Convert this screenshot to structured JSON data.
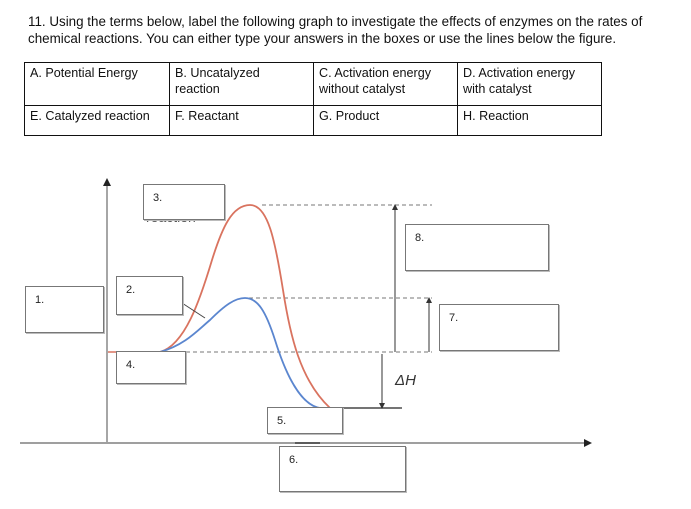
{
  "question": {
    "text": "11.  Using the terms below, label the following graph to investigate the effects of enzymes on the rates of chemical reactions. You can either type your answers in the boxes or use the lines below the figure."
  },
  "terms": [
    [
      "A. Potential Energy",
      "B. Uncatalyzed reaction",
      "C. Activation energy without catalyst",
      "D. Activation energy with catalyst"
    ],
    [
      "E. Catalyzed reaction",
      "F. Reactant",
      "G. Product",
      "H. Reaction"
    ]
  ],
  "diagram": {
    "delta_h_label": "ΔH",
    "stray_text": "reaction",
    "curves": {
      "uncatalyzed_color": "#d9735f",
      "catalyzed_color": "#5b86cf"
    },
    "answer_boxes": [
      {
        "label": "1.",
        "value": ""
      },
      {
        "label": "2.",
        "value": ""
      },
      {
        "label": "3.",
        "value": ""
      },
      {
        "label": "4.",
        "value": ""
      },
      {
        "label": "5.",
        "value": ""
      },
      {
        "label": "6.",
        "value": ""
      },
      {
        "label": "7.",
        "value": ""
      },
      {
        "label": "8.",
        "value": ""
      }
    ]
  }
}
